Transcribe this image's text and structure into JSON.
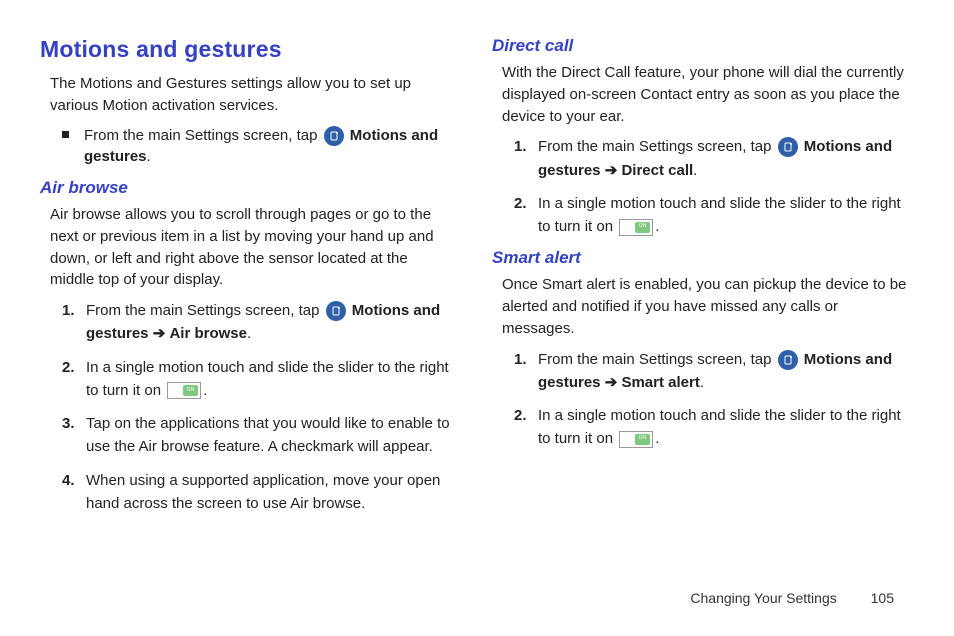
{
  "main_heading": "Motions and gestures",
  "intro": "The Motions and Gestures settings allow you to set up various Motion activation services.",
  "bullet_prefix": "From the main Settings screen, tap ",
  "motions_label": "Motions and gestures",
  "period": ".",
  "arrow": "➔",
  "air_browse": {
    "heading": "Air browse",
    "desc": "Air browse allows you to scroll through pages or go to the next or previous item in a list by moving your hand up and down, or left and right above the sensor located at the middle top of your display.",
    "s1_prefix": "From the main Settings screen, tap ",
    "s1_suffix": "Air browse",
    "s2_prefix": "In a single motion touch and slide the slider to the right to turn it on ",
    "s3": "Tap on the applications that you would like to enable to use the Air browse feature. A checkmark will appear.",
    "s4": "When using a supported application, move your open hand across the screen to use Air browse."
  },
  "direct_call": {
    "heading": "Direct call",
    "desc": "With the Direct Call feature, your phone will dial the currently displayed on-screen Contact entry as soon as you place the device to your ear.",
    "s1_prefix": "From the main Settings screen, tap ",
    "s1_suffix": "Direct call",
    "s2_prefix": "In a single motion touch and slide the slider to the right to turn it on "
  },
  "smart_alert": {
    "heading": "Smart alert",
    "desc": "Once Smart alert is enabled, you can pickup the device to be alerted and notified if you have missed any calls or messages.",
    "s1_prefix": "From the main Settings screen, tap ",
    "s1_suffix": "Smart alert",
    "s2_prefix": "In a single motion touch and slide the slider to the right to turn it on "
  },
  "footer_text": "Changing Your Settings",
  "page_number": "105",
  "nums": {
    "1": "1.",
    "2": "2.",
    "3": "3.",
    "4": "4."
  },
  "toggle_on": "ON"
}
